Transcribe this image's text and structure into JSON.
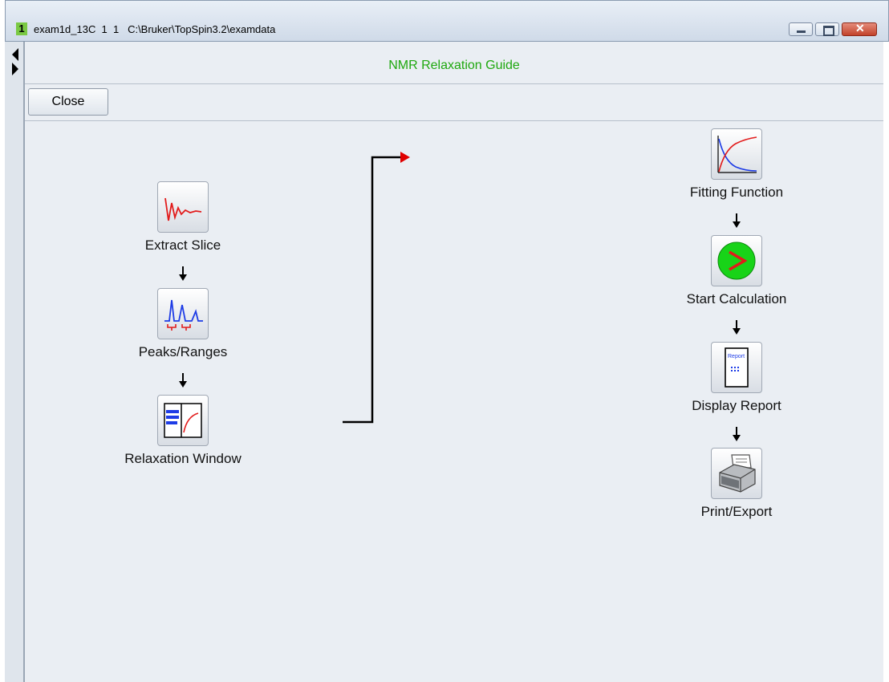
{
  "window": {
    "number": "1",
    "title": "exam1d_13C  1  1   C:\\Bruker\\TopSpin3.2\\examdata"
  },
  "guide": {
    "title": "NMR Relaxation Guide",
    "close_label": "Close"
  },
  "steps": {
    "extract_slice": "Extract Slice",
    "peaks_ranges": "Peaks/Ranges",
    "relaxation_window": "Relaxation Window",
    "fitting_function": "Fitting Function",
    "start_calculation": "Start Calculation",
    "display_report": "Display Report",
    "print_export": "Print/Export"
  },
  "icons": {
    "report_label": "Report"
  },
  "colors": {
    "title_green": "#1fa80f",
    "flow_arrow_red": "#e00000",
    "start_button_green": "#18d318"
  }
}
